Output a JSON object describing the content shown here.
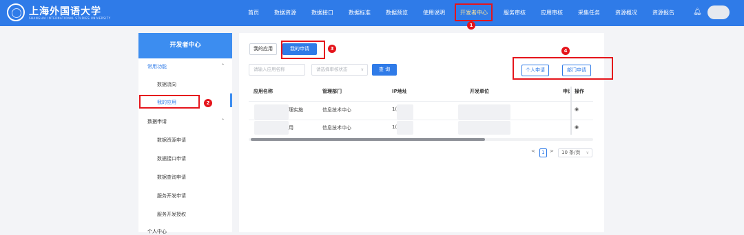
{
  "header": {
    "brand": "上海外国语大学",
    "brand_sub": "SHANGHAI INTERNATIONAL STUDIES UNIVERSITY",
    "nav": [
      "首页",
      "数据资源",
      "数据接口",
      "数据标准",
      "数据预览",
      "使用说明",
      "开发者中心",
      "服务审核",
      "应用审核",
      "采集任务",
      "资源概况",
      "资源报告"
    ],
    "active_nav": "开发者中心"
  },
  "sidebar": {
    "title": "开发者中心",
    "group1": "常用功能",
    "group1_items": [
      "数据流向",
      "我的应用"
    ],
    "group2": "数据申请",
    "group2_items": [
      "数据资源申请",
      "数据接口申请",
      "数据查询申请",
      "服务开发申请",
      "服务开发授权"
    ],
    "group3": "个人中心"
  },
  "main": {
    "tabs": [
      "我的应用",
      "我的申请"
    ],
    "app_name_placeholder": "请输入应用名称",
    "status_placeholder": "请选择审核状态",
    "query_label": "查 询",
    "personal_apply": "个人申请",
    "dept_apply": "部门申请",
    "columns": [
      "应用名称",
      "管理部门",
      "IP地址",
      "开发单位",
      "申请",
      "操作"
    ],
    "rows": [
      {
        "name_tail": "理实施",
        "dept": "信息技术中心",
        "ip": "1("
      },
      {
        "name_tail": "用",
        "dept": "信息技术中心",
        "ip": "1("
      }
    ],
    "pager": {
      "prev": "<",
      "page": "1",
      "next": ">",
      "page_size": "10 条/页"
    }
  },
  "annotations": [
    "1",
    "2",
    "3",
    "4"
  ],
  "colors": {
    "primary": "#2f7be8",
    "annotation": "#e5141b"
  }
}
